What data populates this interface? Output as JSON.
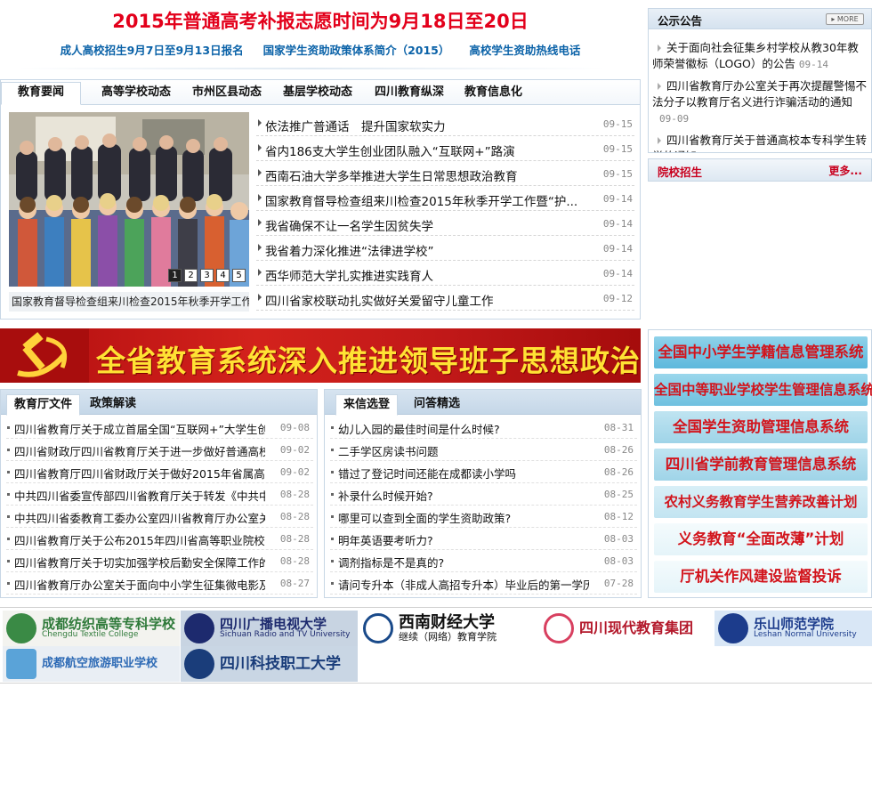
{
  "headline": {
    "title": "2015年普通高考补报志愿时间为9月18日至20日",
    "links": [
      "成人高校招生9月7日至9月13日报名",
      "国家学生资助政策体系简介（2015）",
      "高校学生资助热线电话"
    ]
  },
  "news": {
    "tabs": [
      "教育要闻",
      "高等学校动态",
      "市州区县动态",
      "基层学校动态",
      "四川教育纵深",
      "教育信息化"
    ],
    "slide_pages": [
      "1",
      "2",
      "3",
      "4",
      "5"
    ],
    "slide_caption": "国家教育督导检查组来川检查2015年秋季开学工作",
    "items": [
      {
        "title": "依法推广普通话　提升国家软实力",
        "date": "09-15"
      },
      {
        "title": "省内186支大学生创业团队融入“互联网+”路演",
        "date": "09-15"
      },
      {
        "title": "西南石油大学多举推进大学生日常思想政治教育",
        "date": "09-15"
      },
      {
        "title": "国家教育督导检查组来川检查2015年秋季开学工作暨“护...",
        "date": "09-14"
      },
      {
        "title": "我省确保不让一名学生因贫失学",
        "date": "09-14"
      },
      {
        "title": "我省着力深化推进“法律进学校”",
        "date": "09-14"
      },
      {
        "title": "西华师范大学扎实推进实践育人",
        "date": "09-14"
      },
      {
        "title": "四川省家校联动扎实做好关爱留守儿童工作",
        "date": "09-12"
      }
    ]
  },
  "notice": {
    "title": "公示公告",
    "more": "MORE",
    "items": [
      {
        "title": "关于面向社会征集乡村学校从教30年教师荣誉徽标（LOGO）的公告",
        "date": "09-14"
      },
      {
        "title": "四川省教育厅办公室关于再次提醒警惕不法分子以教育厅名义进行诈骗活动的通知",
        "date": "09-09"
      },
      {
        "title": "四川省教育厅关于普通高校本专科学生转学的通知",
        "date": ""
      }
    ]
  },
  "admission": {
    "title": "院校招生",
    "more": "更多..."
  },
  "banner": {
    "text": "全省教育系统深入推进领导班子思想政治建设"
  },
  "systems": [
    "全国中小学生学籍信息管理系统",
    "全国中等职业学校学生管理信息系统",
    "全国学生资助管理信息系统",
    "四川省学前教育管理信息系统",
    "农村义务教育学生营养改善计划",
    "义务教育“全面改薄”计划",
    "厅机关作风建设监督投诉"
  ],
  "docs": {
    "tabs": [
      "教育厅文件",
      "政策解读"
    ],
    "items": [
      {
        "title": "四川省教育厅关于成立首届全国“互联网+”大学生创",
        "date": "09-08"
      },
      {
        "title": "四川省财政厅四川省教育厅关于进一步做好普通高校",
        "date": "09-02"
      },
      {
        "title": "四川省教育厅四川省财政厅关于做好2015年省属高校",
        "date": "09-02"
      },
      {
        "title": "中共四川省委宣传部四川省教育厅关于转发《中共中",
        "date": "08-28"
      },
      {
        "title": "中共四川省委教育工委办公室四川省教育厅办公室关",
        "date": "08-28"
      },
      {
        "title": "四川省教育厅关于公布2015年四川省高等职业院校信",
        "date": "08-28"
      },
      {
        "title": "四川省教育厅关于切实加强学校后勤安全保障工作的",
        "date": "08-28"
      },
      {
        "title": "四川省教育厅办公室关于面向中小学生征集微电影及",
        "date": "08-27"
      }
    ]
  },
  "letters": {
    "tabs": [
      "来信选登",
      "问答精选"
    ],
    "items": [
      {
        "title": "幼儿入园的最佳时间是什么时候?",
        "date": "08-31"
      },
      {
        "title": "二手学区房读书问题",
        "date": "08-26"
      },
      {
        "title": "错过了登记时间还能在成都读小学吗",
        "date": "08-26"
      },
      {
        "title": "补录什么时候开始?",
        "date": "08-25"
      },
      {
        "title": "哪里可以查到全面的学生资助政策?",
        "date": "08-12"
      },
      {
        "title": "明年英语要考听力?",
        "date": "08-03"
      },
      {
        "title": "调剂指标是不是真的?",
        "date": "08-03"
      },
      {
        "title": "请问专升本（非成人高招专升本）毕业后的第一学历",
        "date": "07-28"
      }
    ]
  },
  "partners": [
    {
      "main": "成都纺织高等专科学校",
      "sub": "Chengdu Textile College"
    },
    {
      "main": "四川广播电视大学",
      "sub": "Sichuan Radio and TV University"
    },
    {
      "main": "西南财经大学",
      "sub": "继续（网络）教育学院"
    },
    {
      "main": "四川现代教育集团",
      "sub": ""
    },
    {
      "main": "乐山师范学院",
      "sub": "Leshan Normal University"
    },
    {
      "main": "成都航空旅游职业学校",
      "sub": ""
    },
    {
      "main": "四川科技职工大学",
      "sub": ""
    }
  ],
  "colors": {
    "headline_red": "#e3001b",
    "link_blue": "#0a62a8",
    "border": "#c8d7e5",
    "banner_red": "#c01818",
    "banner_text": "#ffe234"
  }
}
